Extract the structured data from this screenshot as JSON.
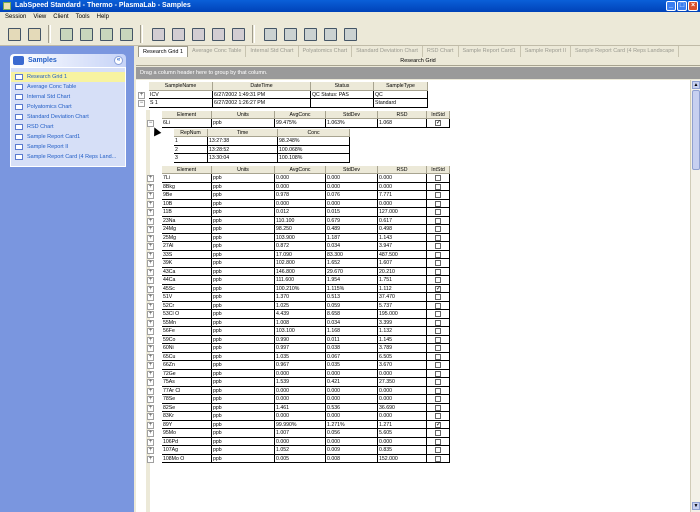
{
  "window": {
    "title": "LabSpeed Standard - Thermo - PlasmaLab - Samples"
  },
  "menu": [
    "Session",
    "View",
    "Client",
    "Tools",
    "Help"
  ],
  "toolbar": {
    "group1": [
      "session-icon",
      "user-icon"
    ],
    "group2": [
      "grid-icon",
      "table-icon",
      "chart-icon",
      "calendar-icon"
    ],
    "group3": [
      "print-preview-icon",
      "export-icon",
      "print-icon",
      "printer-setup-icon",
      "report-icon"
    ],
    "group4": [
      "layout-icon",
      "columns-icon",
      "rows-icon",
      "settings-icon",
      "tools-icon"
    ]
  },
  "sidebar": {
    "title": "Samples",
    "items": [
      {
        "label": "Research Grid 1",
        "active": true
      },
      {
        "label": "Average Conc Table",
        "active": false
      },
      {
        "label": "Internal Std Chart",
        "active": false
      },
      {
        "label": "Polyatomics Chart",
        "active": false
      },
      {
        "label": "Standard Deviation Chart",
        "active": false
      },
      {
        "label": "RSD Chart",
        "active": false
      },
      {
        "label": "Sample Report Card1",
        "active": false
      },
      {
        "label": "Sample Report II",
        "active": false
      },
      {
        "label": "Sample Report Card (4 Reps Land...",
        "active": false
      }
    ]
  },
  "tabs": [
    {
      "label": "Research Grid 1",
      "active": true
    },
    {
      "label": "Average Conc Table",
      "active": false
    },
    {
      "label": "Internal Std Chart",
      "active": false
    },
    {
      "label": "Polyatomics Chart",
      "active": false
    },
    {
      "label": "Standard Deviation Chart",
      "active": false
    },
    {
      "label": "RSD Chart",
      "active": false
    },
    {
      "label": "Sample Report Card1",
      "active": false
    },
    {
      "label": "Sample Report II",
      "active": false
    },
    {
      "label": "Sample Report Card (4 Reps Landscape",
      "active": false
    }
  ],
  "grid": {
    "title": "Research Grid",
    "group_hint": "Drag a column header here to group by that column.",
    "sample_headers": [
      "SampleName",
      "DateTime",
      "Status",
      "SampleType"
    ],
    "samples": [
      {
        "name": "ICV",
        "datetime": "6/27/2002 1:49:31 PM",
        "status": "QC Status: PAS",
        "type": "QC",
        "expanded": false
      },
      {
        "name": "S 1",
        "datetime": "6/27/2002 1:26:27 PM",
        "status": "",
        "type": "Standard",
        "expanded": true
      }
    ],
    "element_headers": [
      "Element",
      "Units",
      "AvgConc",
      "StdDev",
      "RSD",
      "IntStd"
    ],
    "internal_std_row": {
      "element": "6Li",
      "units": "ppb",
      "avg": "99.475%",
      "sd": "1.063%",
      "rsd": "1.068",
      "intstd": true
    },
    "rep_headers": [
      "RepNum",
      "Time",
      "Conc"
    ],
    "reps": [
      {
        "num": "1",
        "time": "13:27:38",
        "conc": "98.248%"
      },
      {
        "num": "2",
        "time": "13:28:52",
        "conc": "100.068%"
      },
      {
        "num": "3",
        "time": "13:30:04",
        "conc": "100.108%"
      }
    ],
    "elements": [
      {
        "element": "7Li",
        "units": "ppb",
        "avg": "0.000",
        "sd": "0.000",
        "rsd": "0.000",
        "intstd": false
      },
      {
        "element": "8Bkg",
        "units": "ppb",
        "avg": "0.000",
        "sd": "0.000",
        "rsd": "0.000",
        "intstd": false
      },
      {
        "element": "9Be",
        "units": "ppb",
        "avg": "0.978",
        "sd": "0.076",
        "rsd": "7.771",
        "intstd": false
      },
      {
        "element": "10B",
        "units": "ppb",
        "avg": "0.000",
        "sd": "0.000",
        "rsd": "0.000",
        "intstd": false
      },
      {
        "element": "11B",
        "units": "ppb",
        "avg": "0.012",
        "sd": "0.015",
        "rsd": "127.000",
        "intstd": false
      },
      {
        "element": "23Na",
        "units": "ppb",
        "avg": "110.100",
        "sd": "0.679",
        "rsd": "0.617",
        "intstd": false
      },
      {
        "element": "24Mg",
        "units": "ppb",
        "avg": "98.250",
        "sd": "0.489",
        "rsd": "0.498",
        "intstd": false
      },
      {
        "element": "25Mg",
        "units": "ppb",
        "avg": "103.900",
        "sd": "1.187",
        "rsd": "1.143",
        "intstd": false
      },
      {
        "element": "27Al",
        "units": "ppb",
        "avg": "0.872",
        "sd": "0.034",
        "rsd": "3.947",
        "intstd": false
      },
      {
        "element": "33S",
        "units": "ppb",
        "avg": "17.090",
        "sd": "83.300",
        "rsd": "487.500",
        "intstd": false
      },
      {
        "element": "39K",
        "units": "ppb",
        "avg": "102.800",
        "sd": "1.652",
        "rsd": "1.607",
        "intstd": false
      },
      {
        "element": "43Ca",
        "units": "ppb",
        "avg": "146.800",
        "sd": "29.670",
        "rsd": "20.210",
        "intstd": false
      },
      {
        "element": "44Ca",
        "units": "ppb",
        "avg": "111.600",
        "sd": "1.954",
        "rsd": "1.751",
        "intstd": false
      },
      {
        "element": "45Sc",
        "units": "ppb",
        "avg": "100.210%",
        "sd": "1.115%",
        "rsd": "1.112",
        "intstd": true
      },
      {
        "element": "51V",
        "units": "ppb",
        "avg": "1.370",
        "sd": "0.513",
        "rsd": "37.470",
        "intstd": false
      },
      {
        "element": "52Cr",
        "units": "ppb",
        "avg": "1.025",
        "sd": "0.059",
        "rsd": "5.737",
        "intstd": false
      },
      {
        "element": "53Cl O",
        "units": "ppb",
        "avg": "4.439",
        "sd": "8.658",
        "rsd": "195.000",
        "intstd": false
      },
      {
        "element": "55Mn",
        "units": "ppb",
        "avg": "1.008",
        "sd": "0.034",
        "rsd": "3.399",
        "intstd": false
      },
      {
        "element": "56Fe",
        "units": "ppb",
        "avg": "103.100",
        "sd": "1.168",
        "rsd": "1.132",
        "intstd": false
      },
      {
        "element": "59Co",
        "units": "ppb",
        "avg": "0.990",
        "sd": "0.011",
        "rsd": "1.145",
        "intstd": false
      },
      {
        "element": "60Ni",
        "units": "ppb",
        "avg": "0.997",
        "sd": "0.038",
        "rsd": "3.789",
        "intstd": false
      },
      {
        "element": "65Cu",
        "units": "ppb",
        "avg": "1.035",
        "sd": "0.067",
        "rsd": "6.505",
        "intstd": false
      },
      {
        "element": "66Zn",
        "units": "ppb",
        "avg": "0.967",
        "sd": "0.035",
        "rsd": "3.670",
        "intstd": false
      },
      {
        "element": "72Ge",
        "units": "ppb",
        "avg": "0.000",
        "sd": "0.000",
        "rsd": "0.000",
        "intstd": false
      },
      {
        "element": "75As",
        "units": "ppb",
        "avg": "1.539",
        "sd": "0.421",
        "rsd": "27.350",
        "intstd": false
      },
      {
        "element": "77Ar Cl",
        "units": "ppb",
        "avg": "0.000",
        "sd": "0.000",
        "rsd": "0.000",
        "intstd": false
      },
      {
        "element": "78Se",
        "units": "ppb",
        "avg": "0.000",
        "sd": "0.000",
        "rsd": "0.000",
        "intstd": false
      },
      {
        "element": "82Se",
        "units": "ppb",
        "avg": "1.461",
        "sd": "0.536",
        "rsd": "36.690",
        "intstd": false
      },
      {
        "element": "83Kr",
        "units": "ppb",
        "avg": "0.000",
        "sd": "0.000",
        "rsd": "0.000",
        "intstd": false
      },
      {
        "element": "89Y",
        "units": "ppb",
        "avg": "99.990%",
        "sd": "1.271%",
        "rsd": "1.271",
        "intstd": true
      },
      {
        "element": "95Mo",
        "units": "ppb",
        "avg": "1.007",
        "sd": "0.056",
        "rsd": "5.605",
        "intstd": false
      },
      {
        "element": "106Pd",
        "units": "ppb",
        "avg": "0.000",
        "sd": "0.000",
        "rsd": "0.000",
        "intstd": false
      },
      {
        "element": "107Ag",
        "units": "ppb",
        "avg": "1.052",
        "sd": "0.009",
        "rsd": "0.835",
        "intstd": false
      },
      {
        "element": "108Mo O",
        "units": "ppb",
        "avg": "0.005",
        "sd": "0.008",
        "rsd": "152.000",
        "intstd": false
      }
    ]
  }
}
